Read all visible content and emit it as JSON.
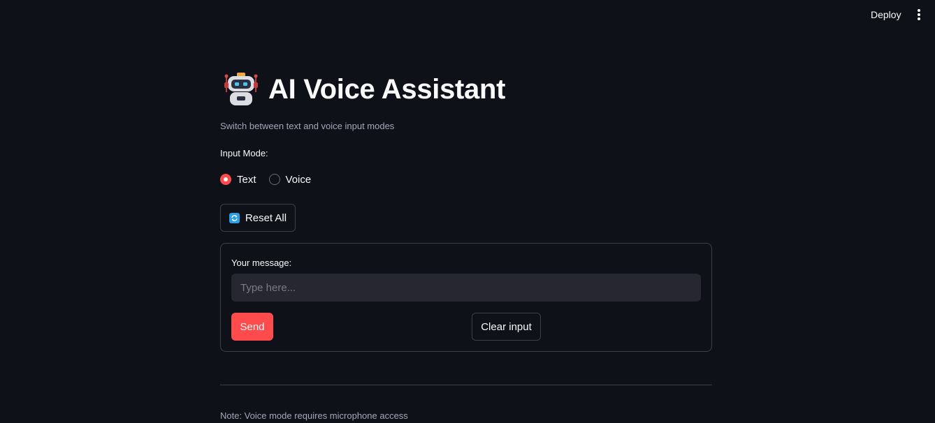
{
  "header": {
    "deploy_label": "Deploy",
    "menu_icon": "vertical-ellipsis-icon"
  },
  "main": {
    "title_icon": "robot-icon",
    "title": "AI Voice Assistant",
    "subtitle": "Switch between text and voice input modes",
    "input_mode": {
      "label": "Input Mode:",
      "options": [
        {
          "label": "Text",
          "selected": true
        },
        {
          "label": "Voice",
          "selected": false
        }
      ]
    },
    "reset_button": {
      "icon": "refresh-icon",
      "label": "Reset All"
    },
    "form": {
      "message_label": "Your message:",
      "message_value": "",
      "message_placeholder": "Type here...",
      "send_label": "Send",
      "clear_label": "Clear input"
    },
    "note": "Note: Voice mode requires microphone access"
  },
  "colors": {
    "background": "#0e1117",
    "accent": "#ff4b4b",
    "input_bg": "#262730",
    "border": "#3d4049"
  }
}
